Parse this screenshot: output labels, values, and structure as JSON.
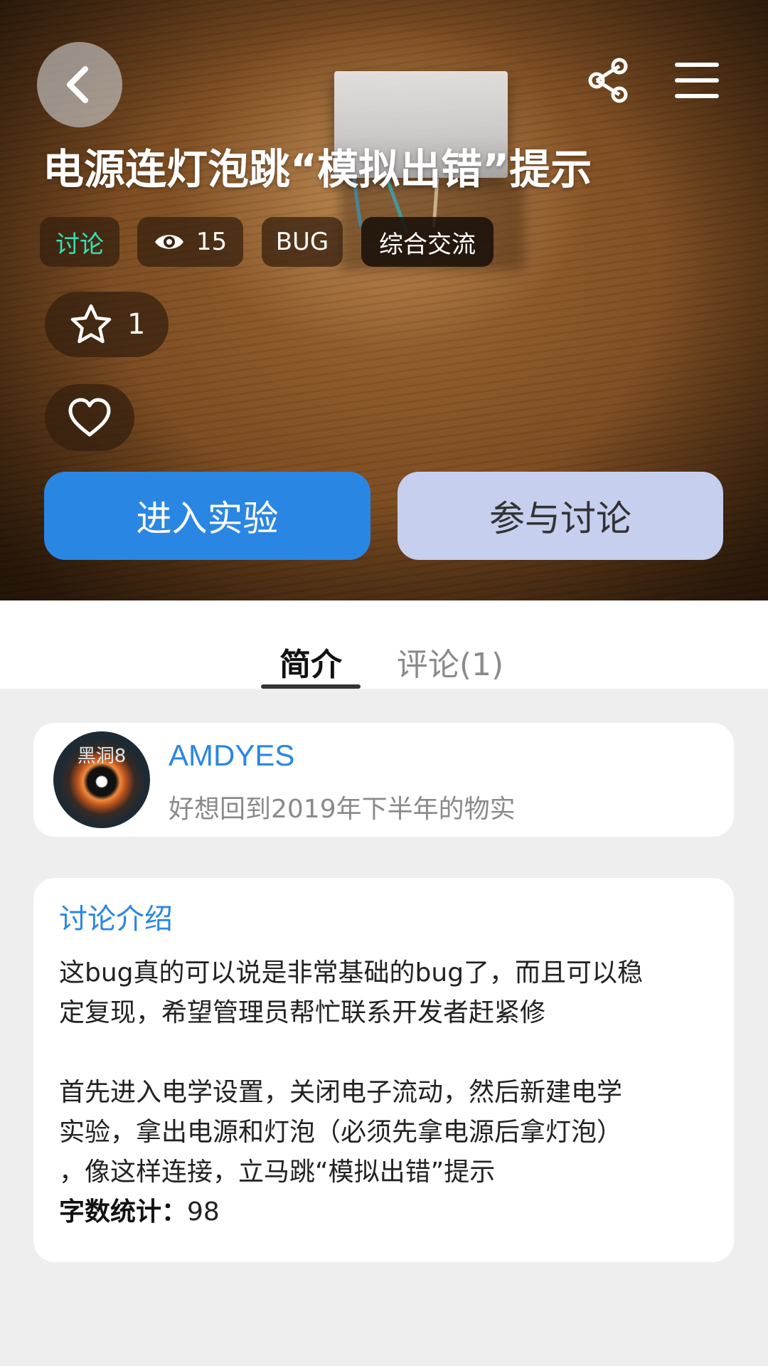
{
  "header": {
    "title": "电源连灯泡跳“模拟出错”提示",
    "tags": {
      "type": "讨论",
      "views": "15",
      "bug": "BUG",
      "category": "综合交流"
    },
    "star_count": "1"
  },
  "actions": {
    "enter_label": "进入实验",
    "discuss_label": "参与讨论"
  },
  "tabs": [
    {
      "label": "简介",
      "active": true
    },
    {
      "label": "评论(1)",
      "active": false
    }
  ],
  "author": {
    "name": "AMDYES",
    "signature": "好想回到2019年下半年的物实",
    "avatar_text": "黑洞8"
  },
  "intro": {
    "heading": "讨论介绍",
    "paragraph1": "这bug真的可以说是非常基础的bug了，而且可以稳\n定复现，希望管理员帮忙联系开发者赶紧修",
    "paragraph2": "首先进入电学设置，关闭电子流动，然后新建电学\n实验，拿出电源和灯泡（必须先拿电源后拿灯泡）\n，像这样连接，立马跳“模拟出错”提示",
    "wordcount_label": "字数统计：",
    "wordcount_value": "98"
  },
  "colors": {
    "accent": "#2a86e3",
    "secondary_button": "#c6cfee",
    "tag_discuss": "#37e0b7"
  },
  "icons": [
    "back-icon",
    "share-icon",
    "menu-icon",
    "eye-icon",
    "star-icon",
    "heart-icon"
  ]
}
